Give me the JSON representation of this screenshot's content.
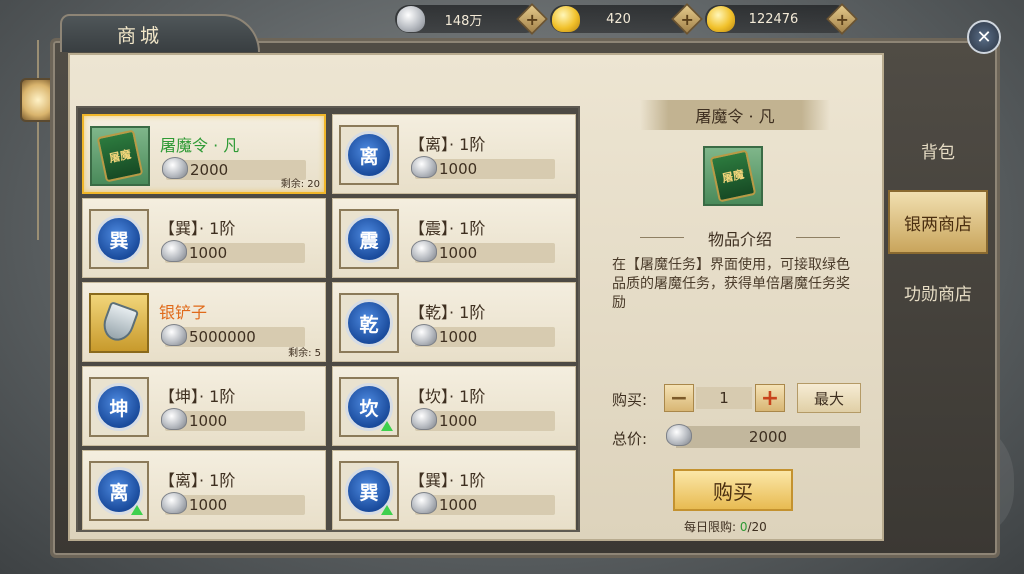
{
  "window": {
    "title": "商城"
  },
  "currencies": [
    {
      "icon": "silver-ingot-icon",
      "value": "148万"
    },
    {
      "icon": "gold-ingot-icon",
      "value": "420"
    },
    {
      "icon": "gold-sycee-icon",
      "value": "122476"
    }
  ],
  "plus_label": "+",
  "close_label": "✕",
  "items": [
    {
      "name": "屠魔令 · 凡",
      "price": "2000",
      "remain": "剩余: 20",
      "icon_text": "屠魔",
      "color": "green"
    },
    {
      "name": "【离】· 1阶",
      "price": "1000",
      "icon_text": "离"
    },
    {
      "name": "【巽】· 1阶",
      "price": "1000",
      "icon_text": "巽"
    },
    {
      "name": "【震】· 1阶",
      "price": "1000",
      "icon_text": "震"
    },
    {
      "name": "银铲子",
      "price": "5000000",
      "remain": "剩余: 5",
      "color": "orange"
    },
    {
      "name": "【乾】· 1阶",
      "price": "1000",
      "icon_text": "乾"
    },
    {
      "name": "【坤】· 1阶",
      "price": "1000",
      "icon_text": "坤"
    },
    {
      "name": "【坎】· 1阶",
      "price": "1000",
      "icon_text": "坎"
    },
    {
      "name": "【离】· 1阶",
      "price": "1000",
      "icon_text": "离"
    },
    {
      "name": "【巽】· 1阶",
      "price": "1000",
      "icon_text": "巽"
    }
  ],
  "detail": {
    "name": "屠魔令 · 凡",
    "icon_text": "屠魔",
    "section_title": "物品介绍",
    "description": "在【屠魔任务】界面使用，可接取绿色品质的屠魔任务，获得单倍屠魔任务奖励",
    "buy_label": "购买:",
    "minus_label": "−",
    "quantity": "1",
    "plus_label": "+",
    "max_label": "最大",
    "total_label": "总价:",
    "total_value": "2000",
    "buy_button": "购买",
    "limit_label": "每日限购: ",
    "limit_used": "0",
    "limit_max": "/20"
  },
  "tabs": [
    {
      "label": "背包",
      "active": false
    },
    {
      "label": "银两商店",
      "active": true
    },
    {
      "label": "功勋商店",
      "active": false
    }
  ]
}
